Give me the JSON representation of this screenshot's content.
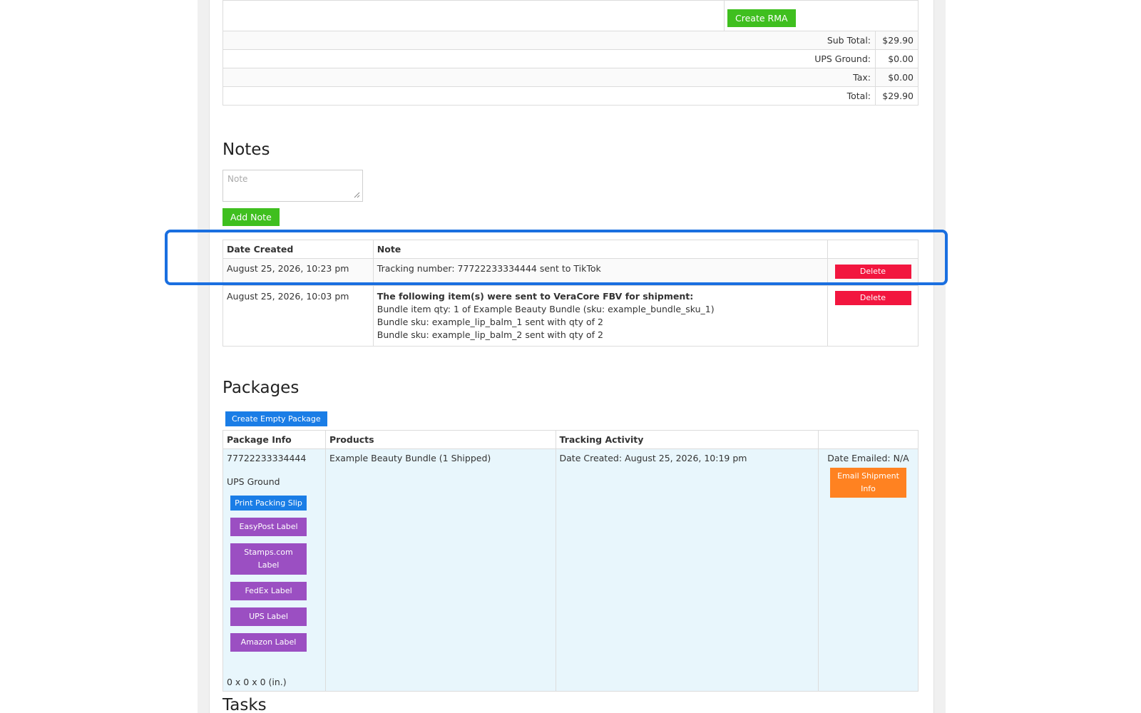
{
  "order": {
    "rma_button": "Create RMA",
    "totals": [
      {
        "label": "Sub Total:",
        "value": "$29.90"
      },
      {
        "label": "UPS Ground:",
        "value": "$0.00"
      },
      {
        "label": "Tax:",
        "value": "$0.00"
      },
      {
        "label": "Total:",
        "value": "$29.90"
      }
    ]
  },
  "notes": {
    "heading": "Notes",
    "input_placeholder": "Note",
    "add_button": "Add Note",
    "columns": [
      "Date Created",
      "Note"
    ],
    "rows": [
      {
        "date": "August 25, 2026, 10:23 pm",
        "note": "Tracking number: 77722233334444 sent to TikTok",
        "delete": "Delete"
      },
      {
        "date": "August 25, 2026, 10:03 pm",
        "note_title": "The following item(s) were sent to VeraCore FBV for shipment:",
        "note_lines": [
          "Bundle item qty: 1 of Example Beauty Bundle (sku: example_bundle_sku_1)",
          "Bundle sku: example_lip_balm_1 sent with qty of 2",
          "Bundle sku: example_lip_balm_2 sent with qty of 2"
        ],
        "delete": "Delete"
      }
    ]
  },
  "packages": {
    "heading": "Packages",
    "create_button": "Create Empty Package",
    "columns": [
      "Package Info",
      "Products",
      "Tracking Activity",
      ""
    ],
    "rows": [
      {
        "tracking_number": "77722233334444",
        "carrier": "UPS Ground",
        "buttons": {
          "print_packing_slip": "Print Packing Slip",
          "easypost": "EasyPost Label",
          "stamps": "Stamps.com Label",
          "fedex": "FedEx Label",
          "ups": "UPS Label",
          "amazon": "Amazon Label"
        },
        "dimensions": "0 x 0 x 0 (in.)",
        "products": "Example Beauty Bundle (1 Shipped)",
        "tracking_activity": "Date Created: August 25, 2026, 10:19 pm",
        "date_emailed": "Date Emailed: N/A",
        "email_button": "Email Shipment Info"
      }
    ]
  },
  "tasks": {
    "heading": "Tasks"
  },
  "colors": {
    "green": "#3fbf1f",
    "blue": "#1a7de6",
    "purple": "#9b4fc2",
    "red": "#f2163f",
    "orange": "#ff8221",
    "highlight": "#1a6fe0",
    "package_row_bg": "#e8f6fc"
  }
}
